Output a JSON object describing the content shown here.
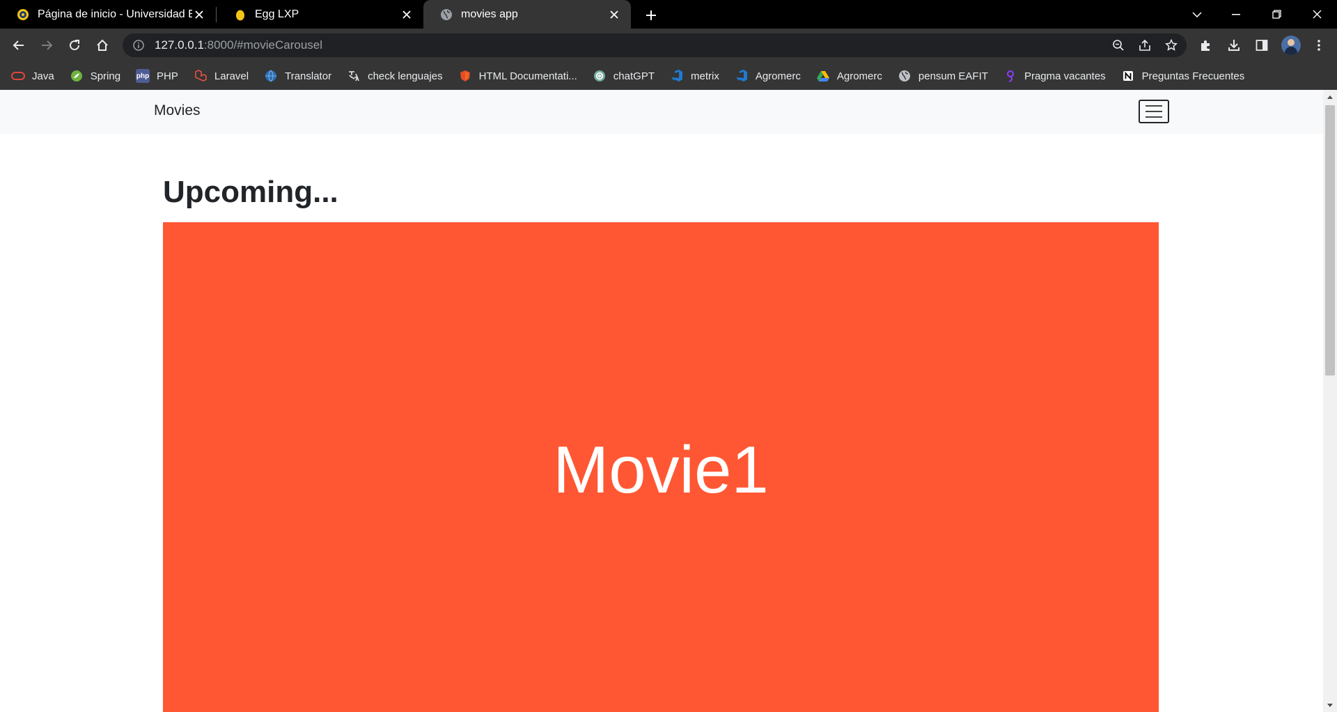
{
  "browser": {
    "tabs": [
      {
        "title": "Página de inicio - Universidad EA",
        "favicon": "university-seal-icon"
      },
      {
        "title": "Egg LXP",
        "favicon": "egg-icon"
      },
      {
        "title": "movies app",
        "favicon": "globe-icon"
      }
    ],
    "active_tab": 2,
    "url_host": "127.0.0.1",
    "url_rest": ":8000/#movieCarousel",
    "bookmarks": [
      {
        "label": "Java",
        "icon": "oracle-icon",
        "color": "#e0463a"
      },
      {
        "label": "Spring",
        "icon": "spring-icon",
        "color": "#6db33f"
      },
      {
        "label": "PHP",
        "icon": "php-icon",
        "color": "#4f5b93"
      },
      {
        "label": "Laravel",
        "icon": "laravel-icon",
        "color": "#f05340"
      },
      {
        "label": "Translator",
        "icon": "translator-globe-icon",
        "color": "#2b6cb0"
      },
      {
        "label": "check lenguajes",
        "icon": "translate-icon",
        "color": "#e8eaed"
      },
      {
        "label": "HTML Documentati...",
        "icon": "html-shield-icon",
        "color": "#e44d26"
      },
      {
        "label": "chatGPT",
        "icon": "chatgpt-icon",
        "color": "#74aa9c"
      },
      {
        "label": "metrix",
        "icon": "azure-devops-icon",
        "color": "#1f7ad1"
      },
      {
        "label": "Agromerc",
        "icon": "azure-devops-icon",
        "color": "#1f7ad1"
      },
      {
        "label": "Agromerc",
        "icon": "google-drive-icon",
        "color": "#34a853"
      },
      {
        "label": "pensum EAFIT",
        "icon": "globe-icon",
        "color": "#bdc1c6"
      },
      {
        "label": "Pragma vacantes",
        "icon": "pragma-icon",
        "color": "#8b3dff"
      },
      {
        "label": "Preguntas Frecuentes",
        "icon": "notion-icon",
        "color": "#ffffff"
      }
    ]
  },
  "page": {
    "brand": "Movies",
    "heading": "Upcoming...",
    "carousel": {
      "slide_text": "Movie1",
      "slide_color": "#ff5733"
    }
  }
}
